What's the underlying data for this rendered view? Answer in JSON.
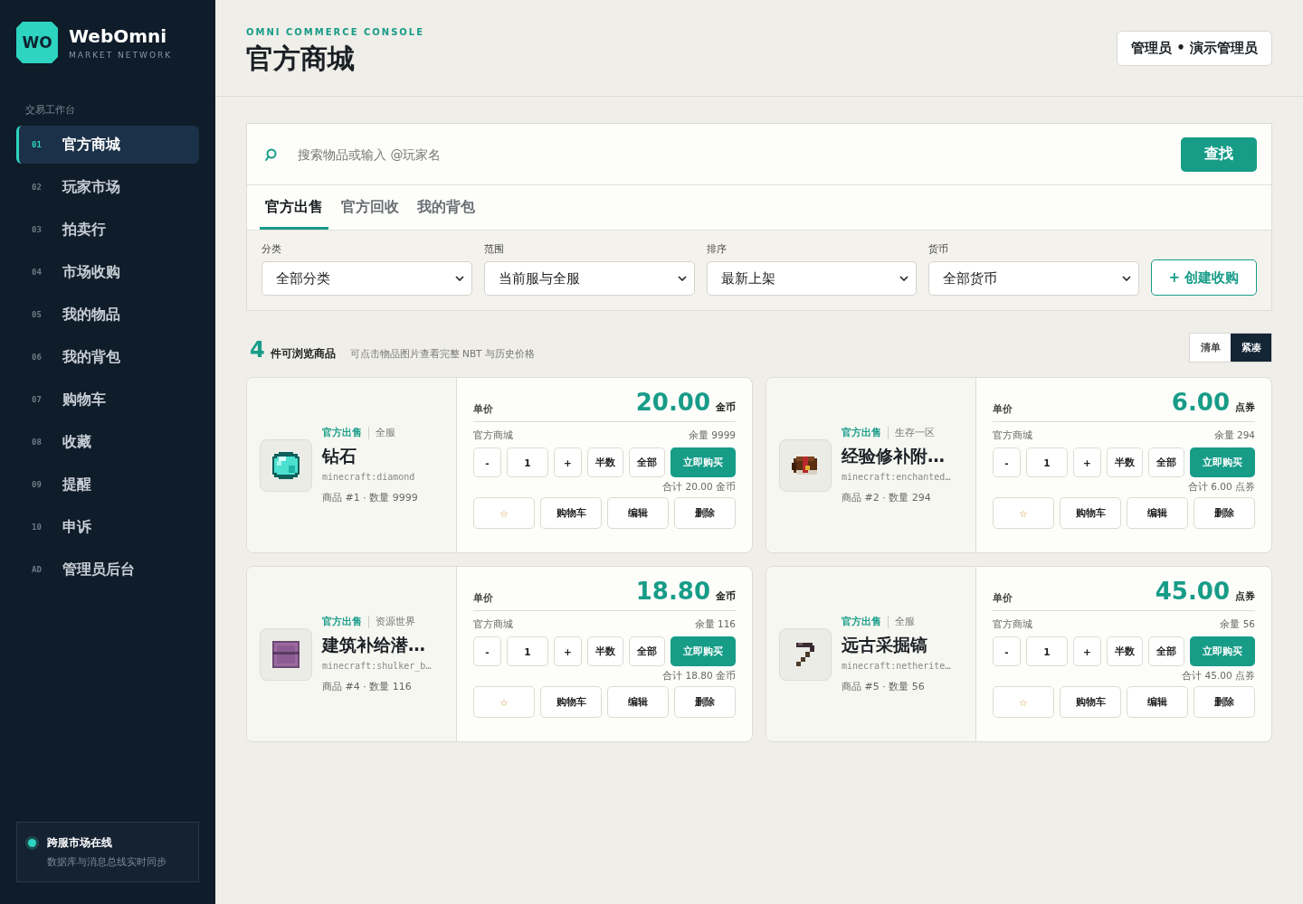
{
  "brand": {
    "logo": "WO",
    "name": "WebOmni",
    "tagline": "MARKET NETWORK"
  },
  "sidebar": {
    "section": "交易工作台",
    "items": [
      {
        "code": "01",
        "label": "官方商城",
        "selected": true
      },
      {
        "code": "02",
        "label": "玩家市场",
        "selected": false
      },
      {
        "code": "03",
        "label": "拍卖行",
        "selected": false
      },
      {
        "code": "04",
        "label": "市场收购",
        "selected": false
      },
      {
        "code": "05",
        "label": "我的物品",
        "selected": false
      },
      {
        "code": "06",
        "label": "我的背包",
        "selected": false
      },
      {
        "code": "07",
        "label": "购物车",
        "selected": false
      },
      {
        "code": "08",
        "label": "收藏",
        "selected": false
      },
      {
        "code": "09",
        "label": "提醒",
        "selected": false
      },
      {
        "code": "10",
        "label": "申诉",
        "selected": false
      },
      {
        "code": "AD",
        "label": "管理员后台",
        "selected": false
      }
    ],
    "status": {
      "title": "跨服市场在线",
      "subtitle": "数据库与消息总线实时同步",
      "online": true
    }
  },
  "header": {
    "eyebrow": "OMNI COMMERCE CONSOLE",
    "title": "官方商城",
    "user": "管理员 • 演示管理员"
  },
  "search": {
    "placeholder": "搜索物品或输入 @玩家名",
    "button": "查找"
  },
  "tabs": [
    {
      "label": "官方出售",
      "selected": true
    },
    {
      "label": "官方回收",
      "selected": false
    },
    {
      "label": "我的背包",
      "selected": false
    }
  ],
  "filters": [
    {
      "label": "分类",
      "value": "全部分类"
    },
    {
      "label": "范围",
      "value": "当前服与全服"
    },
    {
      "label": "排序",
      "value": "最新上架"
    },
    {
      "label": "货币",
      "value": "全部货币"
    }
  ],
  "create_button": "+ 创建收购",
  "summary": {
    "count": "4",
    "label": "件可浏览商品",
    "hint": "可点击物品图片查看完整 NBT 与历史价格"
  },
  "view_modes": [
    {
      "label": "清单",
      "selected": false
    },
    {
      "label": "紧凑",
      "selected": true
    }
  ],
  "products": [
    {
      "kind": "diamond",
      "tag": "官方出售",
      "scope": "全服",
      "name": "钻石",
      "id": "minecraft:diamond",
      "meta": "商品 #1 · 数量 9999",
      "price_label": "单价",
      "price": "20.00",
      "unit": "金币",
      "seller": "官方商城",
      "stock": "余量 9999",
      "stepper": [
        "-",
        "1",
        "+"
      ],
      "quick": [
        "半数",
        "全部"
      ],
      "buy": "立即购买",
      "total": "合计 20.00 金币",
      "actions": [
        "☆",
        "购物车",
        "编辑",
        "删除"
      ]
    },
    {
      "kind": "book",
      "tag": "官方出售",
      "scope": "生存一区",
      "name": "经验修补附…",
      "id": "minecraft:enchanted…",
      "meta": "商品 #2 · 数量 294",
      "price_label": "单价",
      "price": "6.00",
      "unit": "点券",
      "seller": "官方商城",
      "stock": "余量 294",
      "stepper": [
        "-",
        "1",
        "+"
      ],
      "quick": [
        "半数",
        "全部"
      ],
      "buy": "立即购买",
      "total": "合计 6.00 点券",
      "actions": [
        "☆",
        "购物车",
        "编辑",
        "删除"
      ]
    },
    {
      "kind": "shulker",
      "tag": "官方出售",
      "scope": "资源世界",
      "name": "建筑补给潜…",
      "id": "minecraft:shulker_b…",
      "meta": "商品 #4 · 数量 116",
      "price_label": "单价",
      "price": "18.80",
      "unit": "金币",
      "seller": "官方商城",
      "stock": "余量 116",
      "stepper": [
        "-",
        "1",
        "+"
      ],
      "quick": [
        "半数",
        "全部"
      ],
      "buy": "立即购买",
      "total": "合计 18.80 金币",
      "actions": [
        "☆",
        "购物车",
        "编辑",
        "删除"
      ]
    },
    {
      "kind": "pickaxe",
      "tag": "官方出售",
      "scope": "全服",
      "name": "远古采掘镐",
      "id": "minecraft:netherite…",
      "meta": "商品 #5 · 数量 56",
      "price_label": "单价",
      "price": "45.00",
      "unit": "点券",
      "seller": "官方商城",
      "stock": "余量 56",
      "stepper": [
        "-",
        "1",
        "+"
      ],
      "quick": [
        "半数",
        "全部"
      ],
      "buy": "立即购买",
      "total": "合计 45.00 点券",
      "actions": [
        "☆",
        "购物车",
        "编辑",
        "删除"
      ]
    }
  ]
}
